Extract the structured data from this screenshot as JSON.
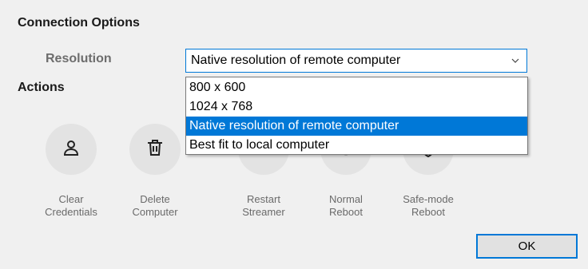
{
  "sections": {
    "connection_title": "Connection Options",
    "actions_title": "Actions"
  },
  "resolution": {
    "label": "Resolution",
    "selected": "Native resolution of remote computer",
    "options": [
      "800 x 600",
      "1024 x 768",
      "Native resolution of remote computer",
      "Best fit to local computer"
    ]
  },
  "actions": [
    {
      "line1": "Clear",
      "line2": "Credentials",
      "icon": "user-icon"
    },
    {
      "line1": "Delete",
      "line2": "Computer",
      "icon": "trash-icon"
    },
    {
      "line1": "Restart",
      "line2": "Streamer",
      "icon": "restart-icon"
    },
    {
      "line1": "Normal",
      "line2": "Reboot",
      "icon": "reboot-icon"
    },
    {
      "line1": "Safe-mode",
      "line2": "Reboot",
      "icon": "shield-icon"
    }
  ],
  "ok_label": "OK",
  "colors": {
    "accent": "#0078d7",
    "background": "#f0f0f0"
  }
}
